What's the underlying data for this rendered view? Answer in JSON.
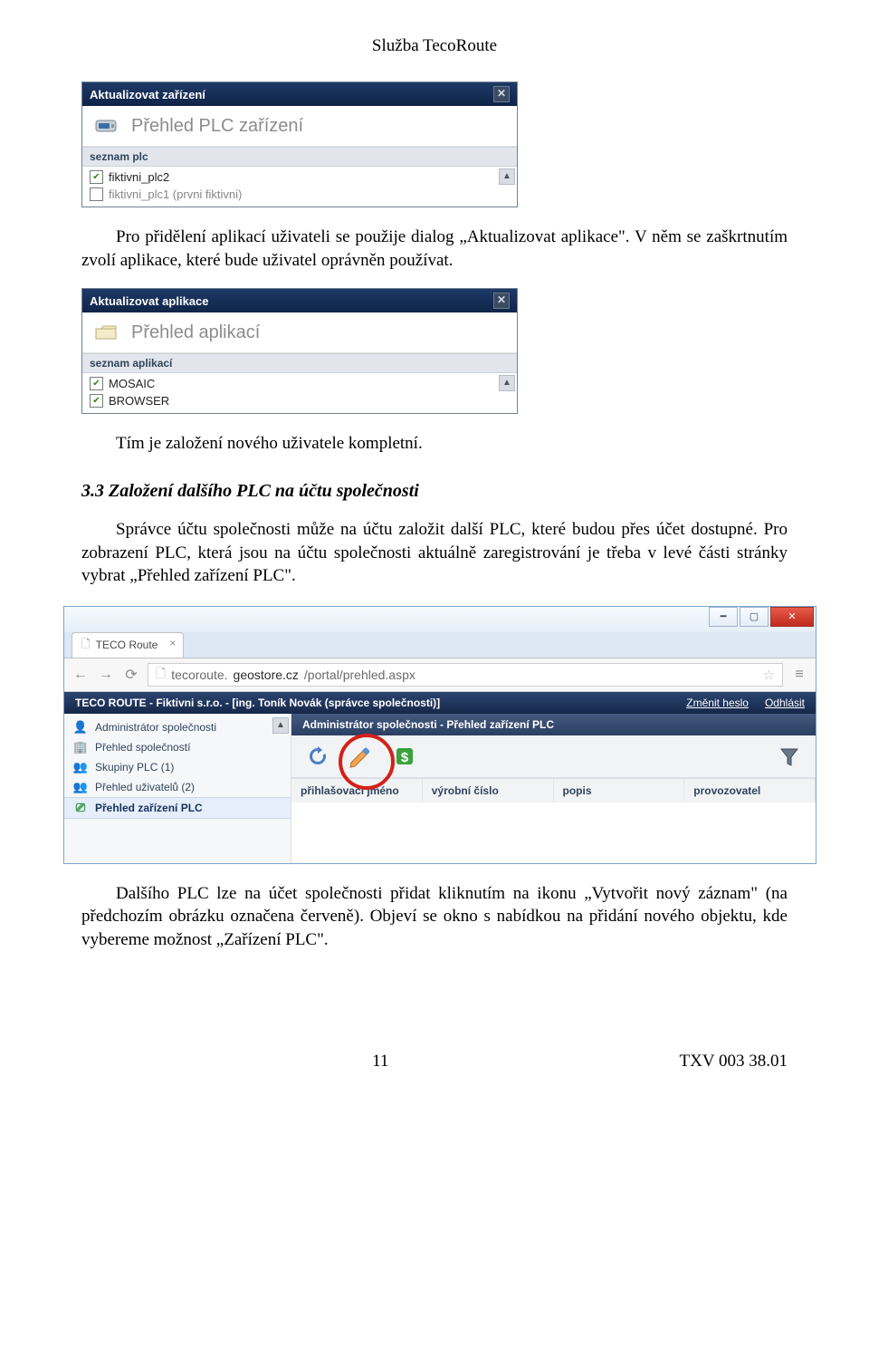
{
  "doc": {
    "header": "Služba TecoRoute",
    "p1": "Pro přidělení aplikací uživateli se použije dialog „Aktualizovat aplikace\". V něm se zaškrtnutím zvolí aplikace, které bude uživatel oprávněn používat.",
    "p2": "Tím je založení nového uživatele kompletní.",
    "heading": "3.3    Založení dalšího PLC na účtu společnosti",
    "p3": "Správce účtu společnosti může na účtu založit další PLC, které budou přes účet dostupné. Pro zobrazení PLC, která jsou na účtu společnosti aktuálně zaregistrování je třeba v levé části stránky vybrat „Přehled zařízení PLC\".",
    "p4": "Dalšího PLC lze na účet společnosti přidat kliknutím na ikonu „Vytvořit nový záznam\" (na předchozím obrázku označena červeně). Objeví se okno s nabídkou na přidání nového objektu, kde vybereme možnost „Zařízení PLC\"."
  },
  "dlg1": {
    "title": "Aktualizovat zařízení",
    "subheader": "Přehled PLC zařízení",
    "section": "seznam plc",
    "items": [
      {
        "label": "fiktivni_plc2",
        "checked": true,
        "dim": false
      },
      {
        "label": "fiktivni_plc1 (prvni fiktivni)",
        "checked": false,
        "dim": true
      }
    ]
  },
  "dlg2": {
    "title": "Aktualizovat aplikace",
    "subheader": "Přehled aplikací",
    "section": "seznam aplikací",
    "items": [
      {
        "label": "MOSAIC",
        "checked": true
      },
      {
        "label": "BROWSER",
        "checked": true
      }
    ]
  },
  "browser": {
    "tab": "TECO Route",
    "url_prefix": "tecoroute.",
    "url_host": "geostore.cz",
    "url_path": "/portal/prehled.aspx",
    "app_title": "TECO ROUTE - Fiktivni s.r.o. - [ing. Toník Novák (správce společnosti)]",
    "link_pass": "Změnit heslo",
    "link_logout": "Odhlásit",
    "sidebar": [
      "Administrátor společnosti",
      "Přehled společností",
      "Skupiny PLC (1)",
      "Přehled uživatelů (2)",
      "Přehled zařízení PLC"
    ],
    "main_title": "Administrátor společnosti - Přehled zařízení PLC",
    "columns": [
      "přihlašovací jméno",
      "výrobní číslo",
      "popis",
      "provozovatel"
    ]
  },
  "footer": {
    "page": "11",
    "docid": "TXV 003 38.01"
  }
}
